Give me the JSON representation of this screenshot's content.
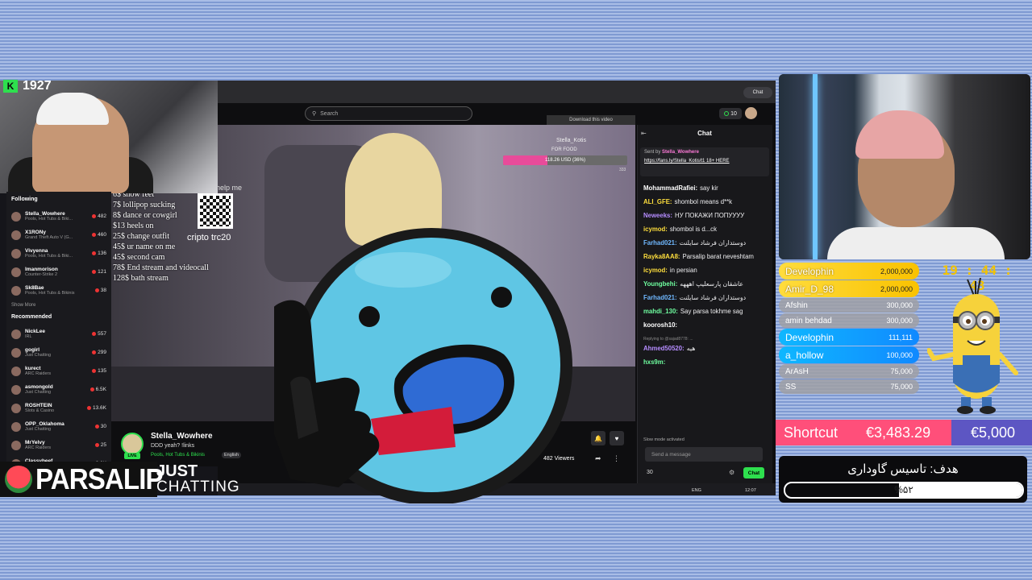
{
  "streamer_overlay": {
    "counter": "1927",
    "brand_name": "PARSALIP",
    "category_line1": "JUST",
    "category_line2": "CHATTING"
  },
  "browser": {
    "search_placeholder": "Search",
    "coins": "10",
    "chat_pill": "Chat"
  },
  "sidebar": {
    "following_header": "Following",
    "recommended_header": "Recommended",
    "show_more": "Show More",
    "following": [
      {
        "name": "Stella_Wowhere",
        "sub": "Pools, Hot Tubs & Biki...",
        "count": "482"
      },
      {
        "name": "X1RONy",
        "sub": "Grand Theft Auto V (G...",
        "count": "460"
      },
      {
        "name": "Vivyenna",
        "sub": "Pools, Hot Tubs & Biki...",
        "count": "136"
      },
      {
        "name": "lmanmorison",
        "sub": "Counter-Strike 2",
        "count": "121"
      },
      {
        "name": "Sk8Bae",
        "sub": "Pools, Hot Tubs & Bikinis",
        "count": "38"
      }
    ],
    "recommended": [
      {
        "name": "NickLee",
        "sub": "IRL",
        "count": "557"
      },
      {
        "name": "gogirl",
        "sub": "Just Chatting",
        "count": "299"
      },
      {
        "name": "kurect",
        "sub": "ARC Raiders",
        "count": "135"
      },
      {
        "name": "asmongold",
        "sub": "Just Chatting",
        "count": "6.5K"
      },
      {
        "name": "ROSHTEIN",
        "sub": "Slots & Casino",
        "count": "13.6K"
      },
      {
        "name": "OPP_Oklahoma",
        "sub": "Just Chatting",
        "count": "30"
      },
      {
        "name": "MrYelvy",
        "sub": "ARC Raiders",
        "count": "25"
      },
      {
        "name": "Classybeef",
        "sub": "Slots & Casino",
        "count": "2.6K"
      }
    ]
  },
  "video": {
    "menu": [
      "6$ show feet",
      "7$ lollipop sucking",
      "8$ dance or cowgirl",
      "$13 heels on",
      "25$ change outfit",
      "45$ ur name on me",
      "45$ second cam",
      "78$ End stream and videocall",
      "128$ bath stream"
    ],
    "crypto": "cripto trc20",
    "help": "help me",
    "download": "Download this video",
    "stream_name": "Stella_Kotis",
    "goal_label": "FOR FOOD",
    "goal_text": "118.26 USD (36%)",
    "goal_percent": 36,
    "goal_right": "333"
  },
  "stream_info": {
    "channel": "Stella_Wowhere",
    "title": "DDD yeah? !links",
    "tags": "Pools, Hot Tubs & Bikinis",
    "language": "English",
    "live": "LIVE",
    "viewers": "482 Viewers"
  },
  "chat": {
    "title": "Chat",
    "pinned_by": "Sent by",
    "pinned_user": "Stella_Wowhere",
    "pinned_link": "https://fans.ly/Stella_Kotis/t1 18+ HERE",
    "messages": [
      {
        "user": "MohammadRafiei:",
        "text": "say kir",
        "color": "#ffffff"
      },
      {
        "user": "ALI_GFE:",
        "text": "shombol means d**k",
        "color": "#ffdf3d"
      },
      {
        "user": "Neweeks:",
        "text": "НУ ПОКАЖИ ПОПУУУУ",
        "color": "#b58cff"
      },
      {
        "user": "icymod:",
        "text": "shombol is d...ck",
        "color": "#ffdf3d"
      },
      {
        "user": "Farhad021:",
        "text": "دوستداران فرشاد سایلنت",
        "color": "#6fb8ff"
      },
      {
        "user": "Rayka8AA8:",
        "text": "Parsalip barat neveshtam",
        "color": "#ffdf3d"
      },
      {
        "user": "icymod:",
        "text": "in persian",
        "color": "#ffdf3d"
      },
      {
        "user": "Youngbehi:",
        "text": "عاشقان پارسعلیپ اهههه",
        "color": "#6fffa0"
      },
      {
        "user": "Farhad021:",
        "text": "دوستداران فرشاد سایلنت",
        "color": "#6fb8ff"
      },
      {
        "user": "mahdi_130:",
        "text": "Say parsa tokhme sag",
        "color": "#6fffa0"
      },
      {
        "user": "koorosh10:",
        "text": "",
        "color": "#ffffff"
      },
      {
        "user": "Ahmed50520:",
        "text": "هیه",
        "color": "#b58cff"
      },
      {
        "user": "hxs9m:",
        "text": "",
        "color": "#6fffa0"
      }
    ],
    "reply_note": "Replying to @sajad8778: ...",
    "slow_mode": "Slow mode activated",
    "input_placeholder": "Send a message",
    "points": "30",
    "send": "Chat"
  },
  "taskbar": {
    "lang": "ENG",
    "time": "12:07"
  },
  "donors": [
    {
      "name": "Develophin",
      "amount": "2,000,000",
      "style": "gold"
    },
    {
      "name": "Amir_D_98",
      "amount": "2,000,000",
      "style": "gold"
    },
    {
      "name": "Afshin",
      "amount": "300,000",
      "style": "gray"
    },
    {
      "name": "amin behdad",
      "amount": "300,000",
      "style": "gray"
    },
    {
      "name": "Develophin",
      "amount": "111,111",
      "style": "blue"
    },
    {
      "name": "a_hollow",
      "amount": "100,000",
      "style": "blue"
    },
    {
      "name": "ArAsH",
      "amount": "75,000",
      "style": "gray"
    },
    {
      "name": "SS",
      "amount": "75,000",
      "style": "gray"
    }
  ],
  "clock": "19 : 44 : 43",
  "shortcut": {
    "name": "Shortcut",
    "amount": "€3,483.29",
    "goal": "€5,000"
  },
  "goal": {
    "title": "هدف: تاسیس گاوداری",
    "percent_text": "%۵۲",
    "percent": 52
  },
  "colors": {
    "twitch_green": "#2ee04e",
    "background_blue": "#a9bde6"
  }
}
